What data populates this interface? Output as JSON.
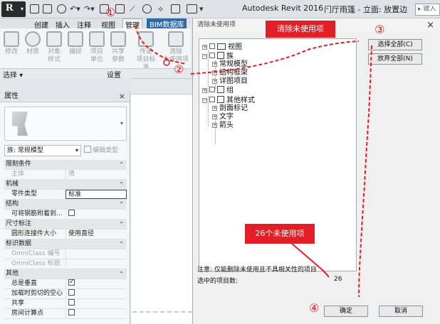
{
  "titlebar": {
    "app_title": "Autodesk Revit 2016 -",
    "view_title": "门厅雨篷 - 立面: 放置边",
    "search_placeholder": "键入",
    "qa_separator": "▸"
  },
  "ribbon": {
    "tabs": [
      "创建",
      "插入",
      "注释",
      "视图",
      "管理",
      "BIM数据库"
    ],
    "active_tab": "管理",
    "tools": [
      "修改",
      "材质",
      "对象\n样式",
      "捕捉",
      "项目\n单位",
      "共享\n参数",
      "传递\n项目标准",
      "清除\n未使用项"
    ],
    "panel_select": "选择 ▾",
    "panel_settings": "设置"
  },
  "properties": {
    "title": "属性",
    "close": "×",
    "family_type": "族: 常规模型",
    "edit_type": "编辑类型",
    "groups": [
      {
        "name": "限制条件",
        "rows": [
          {
            "name": "主体",
            "value": "墙",
            "muted": true
          }
        ]
      },
      {
        "name": "机械",
        "rows": [
          {
            "name": "零件类型",
            "value": "标准",
            "boxed": true
          }
        ]
      },
      {
        "name": "结构",
        "rows": [
          {
            "name": "可将钢筋附着到...",
            "check": false
          }
        ]
      },
      {
        "name": "尺寸标注",
        "rows": [
          {
            "name": "圆形连接件大小",
            "value": "使用直径"
          }
        ]
      },
      {
        "name": "标识数据",
        "rows": [
          {
            "name": "OmniClass 编号",
            "value": "",
            "muted": true
          },
          {
            "name": "OmniClass 标题",
            "value": "",
            "muted": true
          }
        ]
      },
      {
        "name": "其他",
        "rows": [
          {
            "name": "总是垂直",
            "check": true
          },
          {
            "name": "加载时剪切的空心",
            "check": false
          },
          {
            "name": "共享",
            "check": false
          },
          {
            "name": "房间计算点",
            "check": false
          }
        ]
      }
    ]
  },
  "dialog": {
    "title": "清除未使用项",
    "close": "×",
    "tree": {
      "views": "视图",
      "families": "族",
      "generic_models": "常规模型",
      "structural_framing": "结构框架",
      "detail_items": "详图项目",
      "groups": "组",
      "other_styles": "其他样式",
      "section_tags": "剖面标记",
      "text": "文字",
      "arrows": "箭头"
    },
    "check_all": "选择全部(C)",
    "uncheck_all": "放弃全部(N)",
    "note": "注意: 仅能删除未使用且不具相关性的项目",
    "count_label": "选中的项目数:",
    "count_value": "26",
    "ok": "确定",
    "cancel": "取消"
  },
  "annotations": {
    "callout_purge": "清除未使用项",
    "callout_count": "26个未使用项",
    "steps": [
      "①",
      "②",
      "③",
      "④"
    ],
    "color": "#e41e26"
  }
}
